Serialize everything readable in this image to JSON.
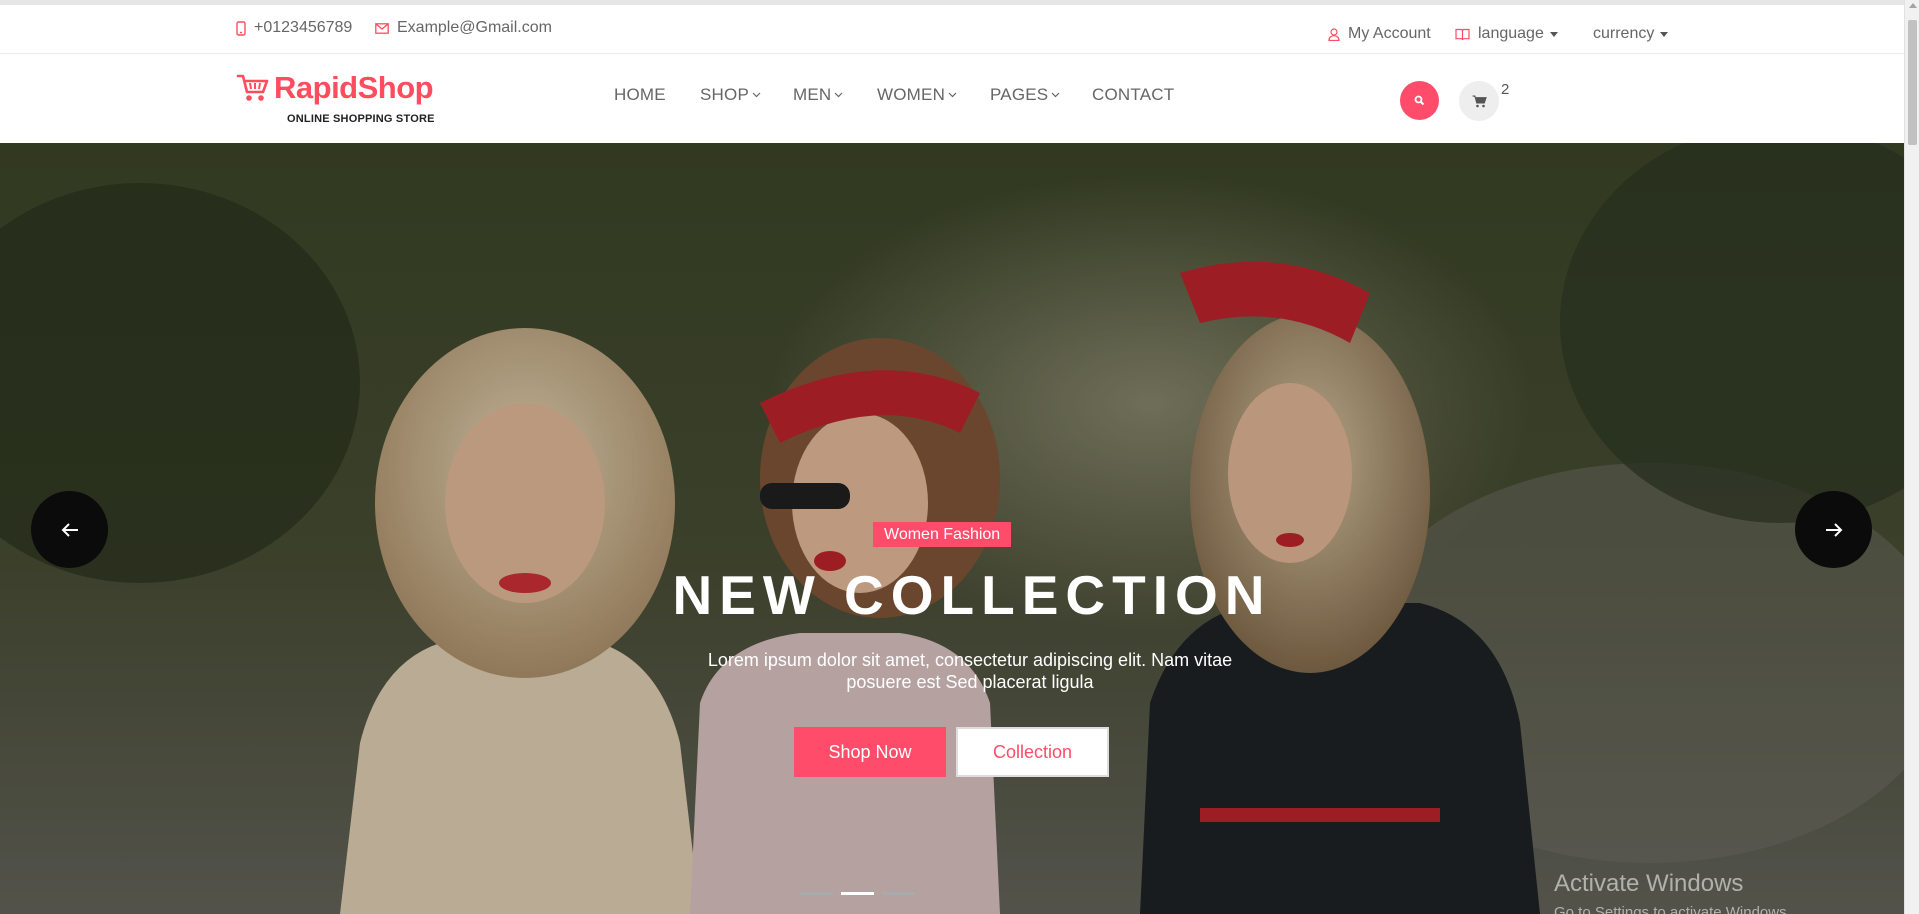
{
  "topbar": {
    "phone": "+0123456789",
    "email": "Example@Gmail.com",
    "account": "My Account",
    "language": "language",
    "currency": "currency"
  },
  "brand": {
    "name": "RapidShop",
    "tagline": "ONLINE SHOPPING STORE",
    "accent_color": "#ff4c6a"
  },
  "nav": {
    "items": [
      {
        "label": "HOME",
        "has_dropdown": false
      },
      {
        "label": "SHOP",
        "has_dropdown": true
      },
      {
        "label": "MEN",
        "has_dropdown": true
      },
      {
        "label": "WOMEN",
        "has_dropdown": true
      },
      {
        "label": "PAGES",
        "has_dropdown": true
      },
      {
        "label": "CONTACT",
        "has_dropdown": false
      }
    ],
    "cart_count": "2"
  },
  "hero": {
    "badge": "Women Fashion",
    "title": "NEW COLLECTION",
    "description": "Lorem ipsum dolor sit amet, consectetur adipiscing elit. Nam vitae posuere est Sed placerat ligula",
    "primary_button": "Shop Now",
    "secondary_button": "Collection",
    "slide_count": 3,
    "active_slide": 2
  },
  "watermark": {
    "line1": "Activate Windows",
    "line2": "Go to Settings to activate Windows."
  },
  "icons": {
    "phone": "phone-icon",
    "email": "mail-icon",
    "account": "user-icon",
    "language": "book-icon",
    "search": "search-icon",
    "cart": "cart-icon",
    "prev": "arrow-left-icon",
    "next": "arrow-right-icon"
  }
}
